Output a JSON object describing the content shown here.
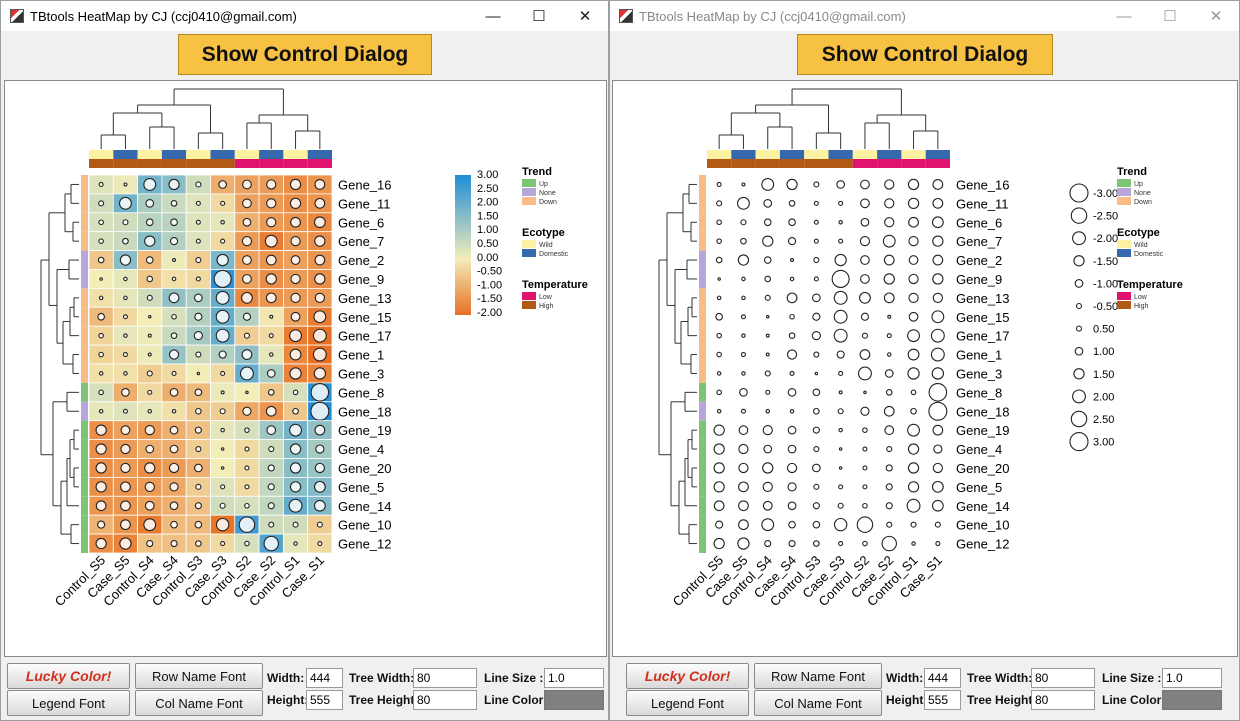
{
  "windows": [
    {
      "title": "TBtools HeatMap by CJ (ccj0410@gmail.com)",
      "show_control_label": "Show Control Dialog",
      "mode": "heatmap",
      "legend_title_trend": "Trend",
      "legend_title_ecotype": "Ecotype",
      "legend_title_temperature": "Temperature",
      "scale_labels": [
        "3.00",
        "2.50",
        "2.00",
        "1.50",
        "1.00",
        "0.50",
        "0.00",
        "-0.50",
        "-1.00",
        "-1.50",
        "-2.00"
      ]
    },
    {
      "title": "TBtools HeatMap by CJ (ccj0410@gmail.com)",
      "show_control_label": "Show Control Dialog",
      "mode": "bubble",
      "legend_title_trend": "Trend",
      "legend_title_ecotype": "Ecotype",
      "legend_title_temperature": "Temperature",
      "scale_labels": [
        "-3.00",
        "-2.50",
        "-2.00",
        "-1.50",
        "-1.00",
        "-0.50",
        "0.50",
        "1.00",
        "1.50",
        "2.00",
        "2.50",
        "3.00"
      ]
    }
  ],
  "window_buttons": {
    "minimize": "—",
    "maximize": "☐",
    "close": "✕"
  },
  "controls": {
    "lucky_color": "Lucky Color!",
    "legend_font": "Legend Font",
    "row_name_font": "Row Name Font",
    "col_name_font": "Col Name Font",
    "width_label": "Width:",
    "width_value": "444",
    "height_label": "Height:",
    "height_value": "555",
    "tree_width_label": "Tree Width:",
    "tree_width_value": "80",
    "tree_height_label": "Tree Height:",
    "tree_height_value": "80",
    "line_size_label": "Line Size :",
    "line_size_value": "1.0",
    "line_color_label": "Line Color:",
    "line_color_hex": "#808080"
  },
  "heatmap": {
    "columns": [
      "Control_S5",
      "Case_S5",
      "Control_S4",
      "Case_S4",
      "Control_S3",
      "Case_S3",
      "Control_S2",
      "Case_S2",
      "Control_S1",
      "Case_S1"
    ],
    "rows": [
      "Gene_16",
      "Gene_11",
      "Gene_6",
      "Gene_7",
      "Gene_2",
      "Gene_9",
      "Gene_13",
      "Gene_15",
      "Gene_17",
      "Gene_1",
      "Gene_3",
      "Gene_8",
      "Gene_18",
      "Gene_19",
      "Gene_4",
      "Gene_20",
      "Gene_5",
      "Gene_14",
      "Gene_10",
      "Gene_12"
    ],
    "values": [
      [
        0.3,
        0.1,
        1.8,
        1.5,
        0.5,
        -1.0,
        -1.2,
        -1.3,
        -1.5,
        -1.4
      ],
      [
        0.5,
        1.8,
        1.0,
        0.6,
        0.3,
        -0.3,
        -1.2,
        -1.3,
        -1.5,
        -1.4
      ],
      [
        0.4,
        0.5,
        0.8,
        0.8,
        0.3,
        0.2,
        -1.0,
        -1.3,
        -1.4,
        -1.6
      ],
      [
        0.4,
        0.6,
        1.5,
        0.9,
        0.3,
        -0.3,
        -1.3,
        -1.8,
        -1.3,
        -1.5
      ],
      [
        -0.6,
        1.5,
        -0.8,
        0.1,
        -0.5,
        1.7,
        -1.2,
        -1.4,
        -1.2,
        -1.4
      ],
      [
        0.0,
        0.2,
        -0.6,
        -0.2,
        -0.3,
        2.8,
        -1.2,
        -1.5,
        -1.3,
        -1.5
      ],
      [
        -0.2,
        0.2,
        0.5,
        1.4,
        1.0,
        2.0,
        -1.6,
        -1.4,
        -1.3,
        -1.3
      ],
      [
        -0.8,
        -0.3,
        0.0,
        0.4,
        0.9,
        2.0,
        0.9,
        -0.1,
        -1.2,
        -1.8
      ],
      [
        -0.4,
        0.2,
        0.1,
        0.6,
        1.1,
        2.0,
        -0.5,
        -0.3,
        -1.8,
        -2.0
      ],
      [
        -0.4,
        -0.3,
        0.1,
        1.3,
        0.5,
        0.9,
        1.4,
        0.2,
        -1.6,
        -2.0
      ],
      [
        -0.2,
        -0.2,
        -0.5,
        -0.3,
        0.0,
        -0.3,
        2.0,
        1.0,
        -1.7,
        -1.7
      ],
      [
        0.4,
        -1.0,
        -0.3,
        -1.0,
        -0.8,
        0.1,
        0.0,
        -0.6,
        0.4,
        2.9
      ],
      [
        0.2,
        0.3,
        0.2,
        -0.2,
        -0.6,
        -0.5,
        -1.1,
        -1.4,
        -0.6,
        3.0
      ],
      [
        -1.5,
        -1.2,
        -1.3,
        -1.0,
        -0.7,
        0.2,
        0.4,
        1.2,
        1.8,
        1.4
      ],
      [
        -1.5,
        -1.3,
        -1.0,
        -1.0,
        -0.5,
        0.0,
        -0.3,
        0.5,
        1.5,
        1.1
      ],
      [
        -1.5,
        -1.3,
        -1.5,
        -1.3,
        -1.0,
        0.0,
        -0.3,
        0.7,
        1.5,
        1.3
      ],
      [
        -1.5,
        -1.4,
        -1.3,
        -1.1,
        -0.5,
        0.3,
        -0.3,
        0.7,
        1.5,
        1.6
      ],
      [
        -1.4,
        -1.4,
        -1.2,
        -1.0,
        -0.7,
        0.5,
        0.4,
        0.7,
        2.0,
        1.6
      ],
      [
        -0.9,
        -1.4,
        -1.8,
        -0.8,
        -0.8,
        -1.9,
        2.5,
        0.5,
        0.5,
        -0.5
      ],
      [
        -1.5,
        -1.7,
        -0.7,
        -0.7,
        -0.6,
        -0.3,
        0.4,
        2.3,
        0.2,
        -0.3
      ]
    ],
    "trend": [
      "Down",
      "Down",
      "Down",
      "Down",
      "None",
      "None",
      "Down",
      "Down",
      "Down",
      "Down",
      "Down",
      "Up",
      "None",
      "Up",
      "Up",
      "Up",
      "Up",
      "Up",
      "Up",
      "Up"
    ],
    "ecotype": [
      "Wild",
      "Domestic",
      "Wild",
      "Domestic",
      "Wild",
      "Domestic",
      "Wild",
      "Domestic",
      "Wild",
      "Domestic"
    ],
    "temperature": [
      "High",
      "High",
      "High",
      "High",
      "High",
      "High",
      "Low",
      "Low",
      "Low",
      "Low"
    ],
    "trend_legend": [
      "Up",
      "None",
      "Down"
    ],
    "ecotype_legend": [
      "Wild",
      "Domestic"
    ],
    "temperature_legend": [
      "Low",
      "High"
    ],
    "colors": {
      "Up": "#7cc576",
      "None": "#b6a6d9",
      "Down": "#f8bd86",
      "Wild": "#fdf2a1",
      "Domestic": "#3568ad",
      "Low": "#e0146e",
      "High": "#b25a14",
      "scale_high": "#1f8dd6",
      "scale_mid": "#f3edb8",
      "scale_low": "#e86f22"
    }
  }
}
